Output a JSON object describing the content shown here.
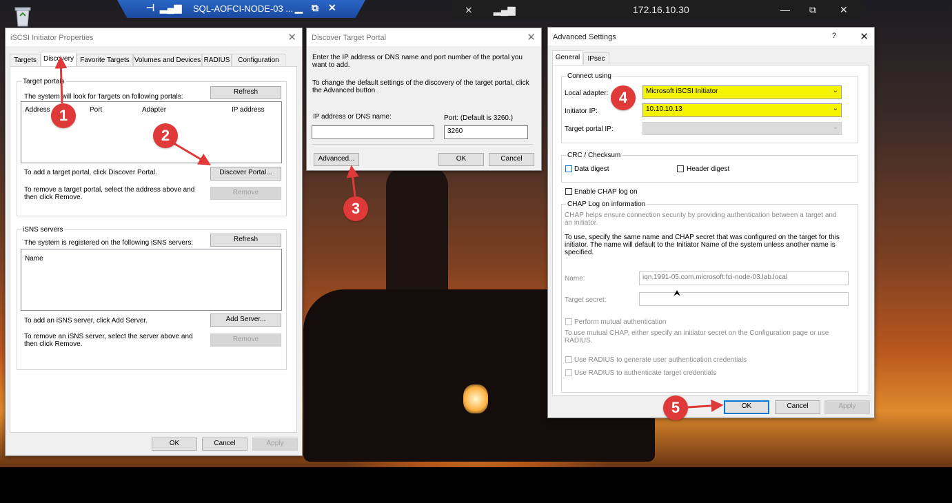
{
  "rdp_bar": {
    "title": "SQL-AOFCI-NODE-03 ..."
  },
  "remote_bar": {
    "ip": "172.16.10.30"
  },
  "iscsi": {
    "title": "iSCSI Initiator Properties",
    "tabs": [
      "Targets",
      "Discovery",
      "Favorite Targets",
      "Volumes and Devices",
      "RADIUS",
      "Configuration"
    ],
    "target_portals": {
      "group_label": "Target portals",
      "desc": "The system will look for Targets on following portals:",
      "refresh": "Refresh",
      "columns": [
        "Address",
        "Port",
        "Adapter",
        "IP address"
      ],
      "add_text": "To add a target portal, click Discover Portal.",
      "discover": "Discover Portal...",
      "remove_text": "To remove a target portal, select the address above and then click Remove.",
      "remove": "Remove"
    },
    "isns": {
      "group_label": "iSNS servers",
      "desc": "The system is registered on the following iSNS servers:",
      "refresh": "Refresh",
      "column": "Name",
      "add_text": "To add an iSNS server, click Add Server.",
      "add": "Add Server...",
      "remove_text": "To remove an iSNS server, select the server above and then click Remove.",
      "remove": "Remove"
    },
    "ok": "OK",
    "cancel": "Cancel",
    "apply": "Apply"
  },
  "discover": {
    "title": "Discover Target Portal",
    "intro": "Enter the IP address or DNS name and port number of the portal you want to add.",
    "advanced_hint": "To change the default settings of the discovery of the target portal, click the Advanced button.",
    "ip_label": "IP address or DNS name:",
    "ip_value": "",
    "port_label": "Port: (Default is 3260.)",
    "port_value": "3260",
    "advanced": "Advanced...",
    "ok": "OK",
    "cancel": "Cancel"
  },
  "advanced": {
    "title": "Advanced Settings",
    "help": "?",
    "tabs": [
      "General",
      "IPsec"
    ],
    "connect_using": "Connect using",
    "local_adapter_label": "Local adapter:",
    "local_adapter_value": "Microsoft iSCSI Initiator",
    "initiator_ip_label": "Initiator IP:",
    "initiator_ip_value": "10.10.10.13",
    "target_portal_ip_label": "Target portal IP:",
    "crc_label": "CRC / Checksum",
    "data_digest": "Data digest",
    "header_digest": "Header digest",
    "enable_chap": "Enable CHAP log on",
    "chap_info": "CHAP Log on information",
    "chap_help": "CHAP helps ensure connection security by providing authentication between a target and an initiator.",
    "chap_use": "To use, specify the same name and CHAP secret that was configured on the target for this initiator.  The name will default to the Initiator Name of the system unless another name is specified.",
    "name_label": "Name:",
    "name_value": "iqn.1991-05.com.microsoft:fci-node-03.lab.local",
    "secret_label": "Target secret:",
    "mutual": "Perform mutual authentication",
    "mutual_help": "To use mutual CHAP, either specify an initiator secret on the Configuration page or use RADIUS.",
    "radius_user": "Use RADIUS to generate user authentication credentials",
    "radius_target": "Use RADIUS to authenticate target credentials",
    "ok": "OK",
    "cancel": "Cancel",
    "apply": "Apply"
  },
  "annotations": [
    "1",
    "2",
    "3",
    "4",
    "5"
  ],
  "colors": {
    "annotation": "#e0393a",
    "highlight": "#f3f300",
    "focus": "#0078d7"
  }
}
